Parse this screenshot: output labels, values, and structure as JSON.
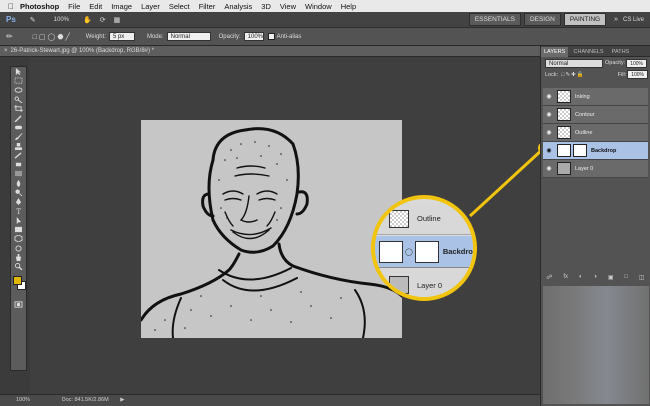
{
  "menubar": {
    "app": "Photoshop",
    "items": [
      "File",
      "Edit",
      "Image",
      "Layer",
      "Select",
      "Filter",
      "Analysis",
      "3D",
      "View",
      "Window",
      "Help"
    ]
  },
  "appbar": {
    "zoom": "100%",
    "workspaces": [
      "ESSENTIALS",
      "DESIGN",
      "PAINTING"
    ],
    "active_workspace": "PAINTING",
    "cs_live": "CS Live"
  },
  "options": {
    "weight_label": "Weight:",
    "weight_value": "5 px",
    "mode_label": "Mode:",
    "mode_value": "Normal",
    "opacity_label": "Opacity:",
    "opacity_value": "100%",
    "antialias_label": "Anti-alias"
  },
  "document": {
    "tab_title": "26-Patrick-Stewart.jpg @ 100% (Backdrop, RGB/8#) *",
    "zoom": "100%",
    "doc_size": "Doc: 841.5K/2.86M"
  },
  "panels": {
    "tabs": [
      "LAYERS",
      "CHANNELS",
      "PATHS"
    ],
    "blend_mode": "Normal",
    "opacity_label": "Opacity:",
    "opacity_value": "100%",
    "lock_label": "Lock:",
    "fill_label": "Fill:",
    "fill_value": "100%",
    "layers": [
      {
        "name": "Inking",
        "selected": false
      },
      {
        "name": "Contour",
        "selected": false
      },
      {
        "name": "Outline",
        "selected": false
      },
      {
        "name": "Backdrop",
        "selected": true
      },
      {
        "name": "Layer 0",
        "selected": false
      }
    ]
  },
  "callout": {
    "rows": [
      "Outline",
      "Backdrop",
      "Layer 0"
    ]
  },
  "colors": {
    "accent": "#f1c40f",
    "selection": "#a9c2e5",
    "foreground_swatch": "#e0b800"
  },
  "icons": [
    "ps-logo-icon",
    "brush-icon",
    "pencil-icon",
    "eye-icon",
    "link-icon",
    "move-icon",
    "lasso-icon",
    "zoom-tool-icon"
  ]
}
